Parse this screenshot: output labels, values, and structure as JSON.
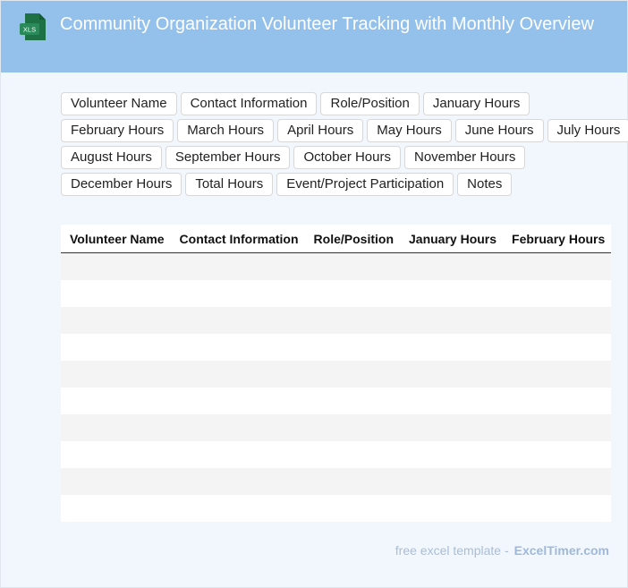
{
  "header": {
    "icon_label": "XLS",
    "title": "Community Organization Volunteer Tracking with Monthly Overview",
    "colors": {
      "header_bg": "#93c1ec",
      "icon_green": "#1e7145"
    }
  },
  "field_tags": [
    [
      "Volunteer Name",
      "Contact Information",
      "Role/Position",
      "January Hours"
    ],
    [
      "February Hours",
      "March Hours",
      "April Hours",
      "May Hours",
      "June Hours",
      "July Hours"
    ],
    [
      "August Hours",
      "September Hours",
      "October Hours",
      "November Hours"
    ],
    [
      "December Hours",
      "Total Hours",
      "Event/Project Participation",
      "Notes"
    ]
  ],
  "table": {
    "columns": [
      "Volunteer Name",
      "Contact Information",
      "Role/Position",
      "January Hours",
      "February Hours"
    ],
    "empty_rows": 10
  },
  "footer": {
    "prefix": "free excel template -",
    "brand": "ExcelTimer.com"
  }
}
